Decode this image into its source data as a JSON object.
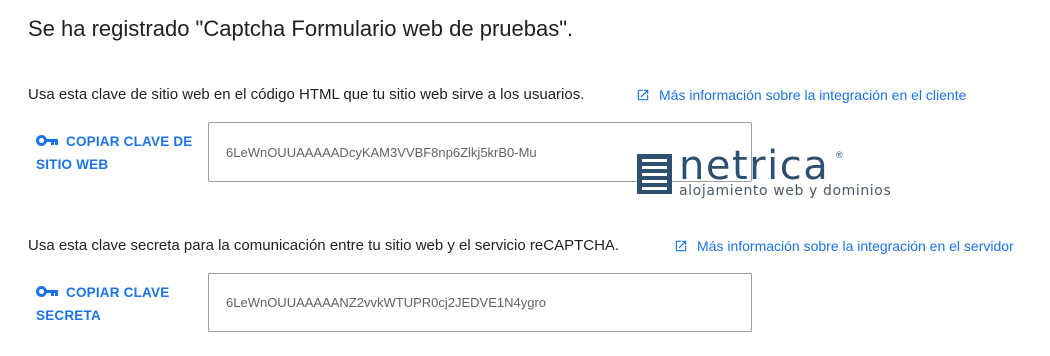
{
  "title": "Se ha registrado \"Captcha Formulario web de pruebas\".",
  "site_key_section": {
    "description": "Usa esta clave de sitio web en el código HTML que tu sitio web sirve a los usuarios.",
    "link_label": "Más información sobre la integración en el cliente",
    "copy_button_label": "COPIAR CLAVE DE SITIO WEB",
    "key_value": "6LeWnOUUAAAAADcyKAM3VVBF8np6Zlkj5krB0-Mu"
  },
  "secret_key_section": {
    "description": "Usa esta clave secreta para la comunicación entre tu sitio web y el servicio reCAPTCHA.",
    "link_label": "Más información sobre la integración en el servidor",
    "copy_button_label": "COPIAR CLAVE SECRETA",
    "key_value": "6LeWnOUUAAAAANZ2vvkWTUPR0cj2JEDVE1N4ygro"
  },
  "watermark": {
    "brand": "netrica",
    "registered": "®",
    "tagline": "alojamiento web y dominios"
  },
  "colors": {
    "accent": "#1a73e8",
    "text": "#202124",
    "muted": "#5f6368",
    "border": "#9aa0a6",
    "brand": "#2e5070"
  },
  "icons": {
    "link": "open-in-new-icon",
    "copy": "vpn-key-icon"
  }
}
